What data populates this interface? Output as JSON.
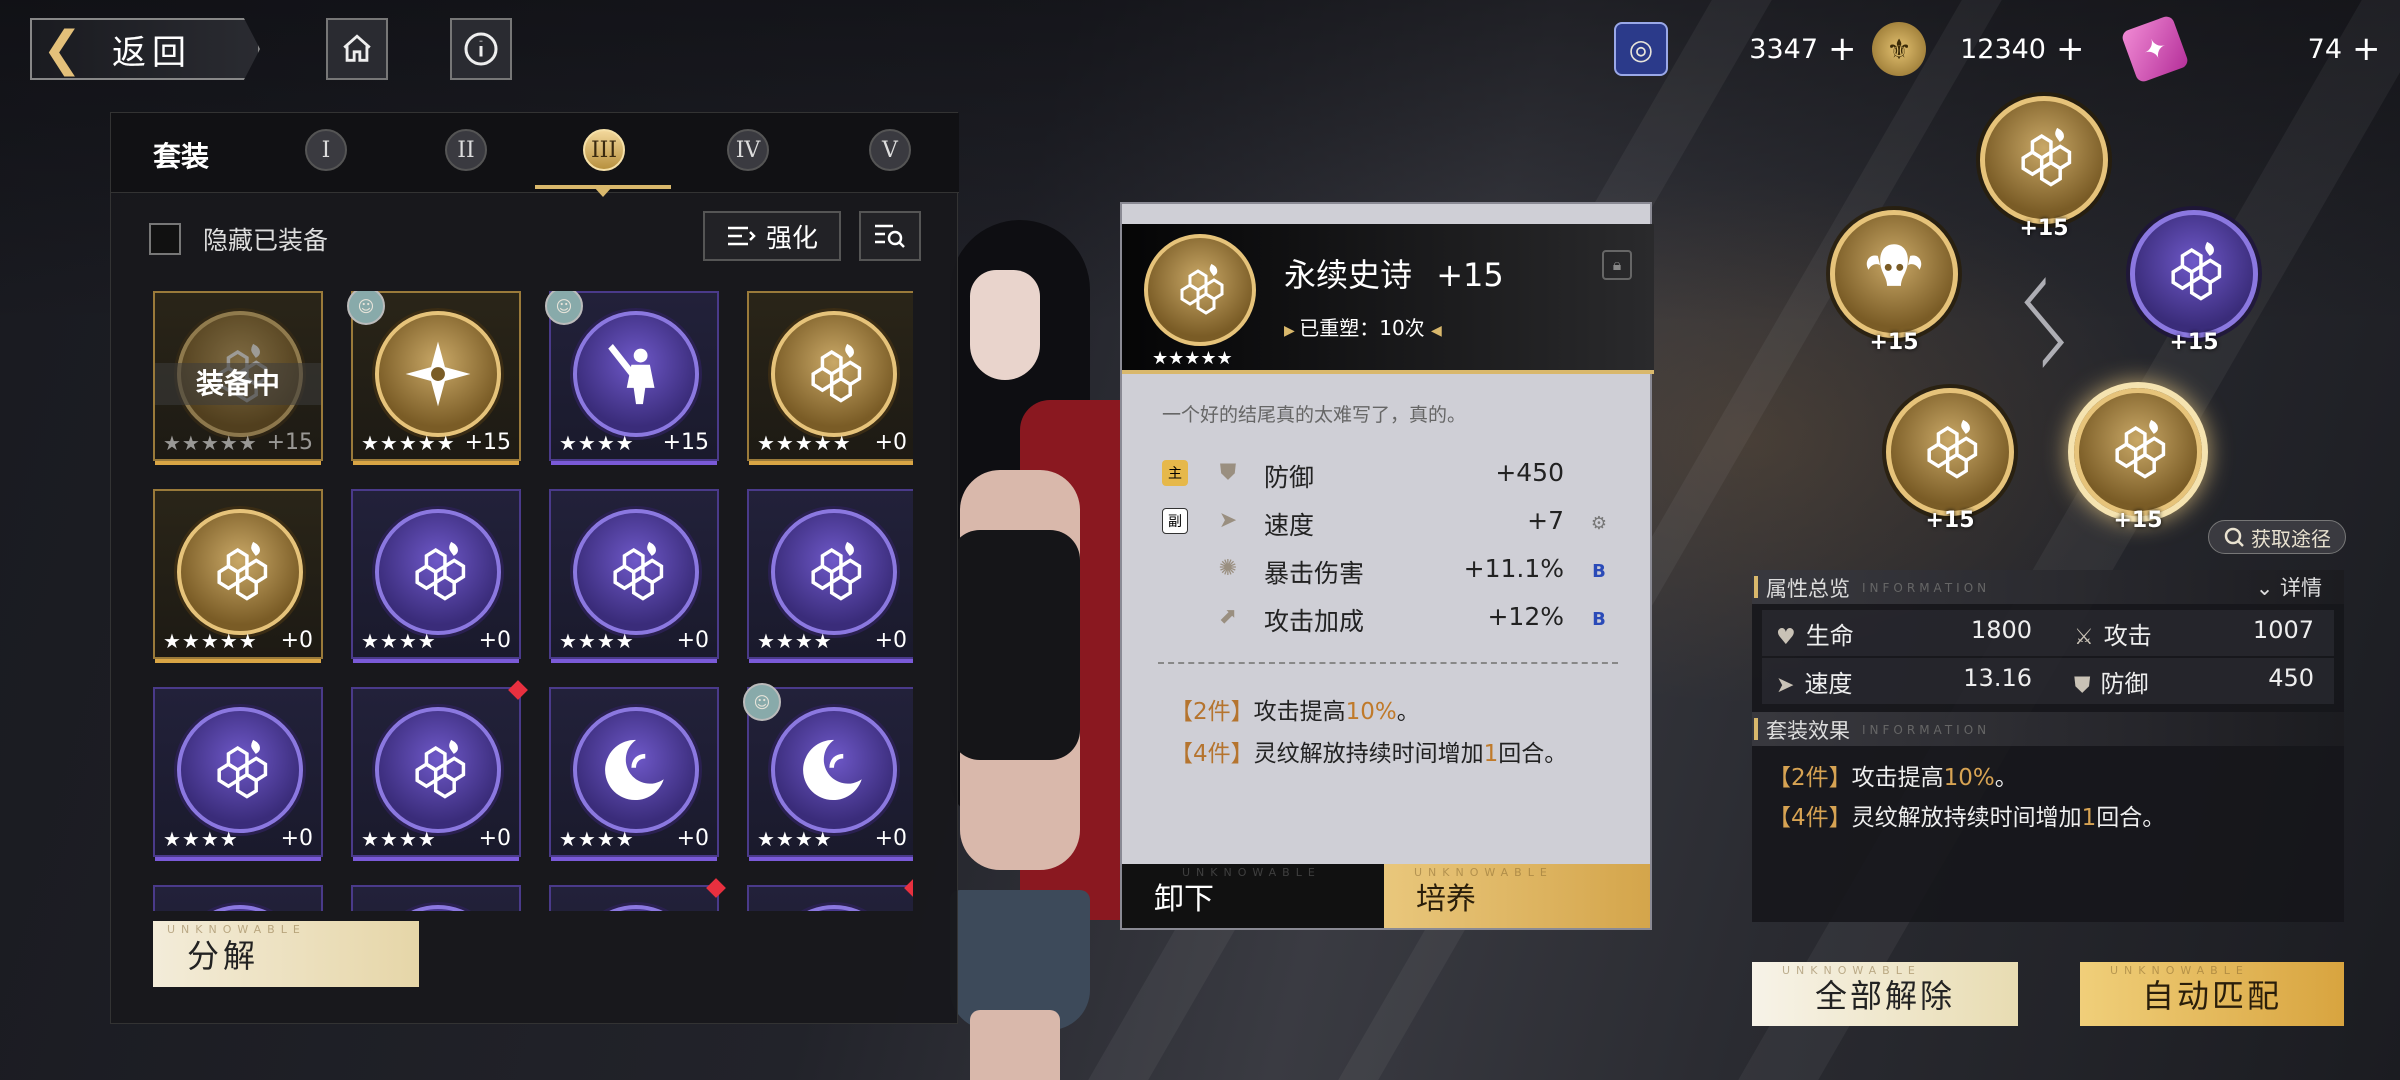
{
  "topbar": {
    "back_label": "返回",
    "home_icon": "home-icon",
    "info_icon": "info-icon",
    "currencies": [
      {
        "icon": "ticket-card-icon",
        "value": "3347",
        "color": "#3a5cc9"
      },
      {
        "icon": "fleur-coin-icon",
        "value": "12340",
        "color": "#c9a24a"
      },
      {
        "icon": "pink-crystal-icon",
        "value": "74",
        "color": "#d84fb5"
      }
    ],
    "plus": "+"
  },
  "left_panel": {
    "title": "套装",
    "tabs": [
      "I",
      "II",
      "III",
      "IV",
      "V"
    ],
    "active_tab": 2,
    "hide_equipped_label": "隐藏已装备",
    "enhance_label": "强化",
    "decompose_label": "分解",
    "watermark": "UNKNOWABLE",
    "cards": [
      {
        "frame": "gold",
        "icon": "hexagon-cluster-icon",
        "stars": "★★★★★",
        "level": "+15",
        "equipped": "装备中",
        "dim": true
      },
      {
        "frame": "gold",
        "icon": "shuriken-star-icon",
        "stars": "★★★★★",
        "level": "+15",
        "avatar": true
      },
      {
        "frame": "purple",
        "icon": "sword-warrior-icon",
        "stars": "★★★★",
        "level": "+15",
        "avatar": true
      },
      {
        "frame": "gold",
        "icon": "hexagon-cluster-icon",
        "stars": "★★★★★",
        "level": "+0"
      },
      {
        "frame": "gold",
        "icon": "hexagon-cluster-icon",
        "stars": "★★★★★",
        "level": "+0"
      },
      {
        "frame": "purple",
        "icon": "hexagon-cluster-icon",
        "stars": "★★★★",
        "level": "+0"
      },
      {
        "frame": "purple",
        "icon": "hexagon-cluster-icon",
        "stars": "★★★★",
        "level": "+0"
      },
      {
        "frame": "purple",
        "icon": "hexagon-cluster-icon",
        "stars": "★★★★",
        "level": "+0"
      },
      {
        "frame": "purple",
        "icon": "hexagon-cluster-icon",
        "stars": "★★★★",
        "level": "+0"
      },
      {
        "frame": "purple",
        "icon": "hexagon-cluster-icon",
        "stars": "★★★★",
        "level": "+0",
        "red": true
      },
      {
        "frame": "purple",
        "icon": "crescent-swirl-icon",
        "stars": "★★★★",
        "level": "+0"
      },
      {
        "frame": "purple",
        "icon": "crescent-swirl-icon",
        "stars": "★★★★",
        "level": "+0",
        "avatar": true
      },
      {
        "frame": "purple",
        "icon": "hexagon-cluster-icon",
        "stars": "",
        "level": ""
      },
      {
        "frame": "purple",
        "icon": "hexagon-cluster-icon",
        "stars": "",
        "level": ""
      },
      {
        "frame": "purple",
        "icon": "hexagon-cluster-icon",
        "stars": "",
        "level": "",
        "red": true
      },
      {
        "frame": "purple",
        "icon": "hexagon-cluster-icon",
        "stars": "",
        "level": "",
        "red": true
      }
    ]
  },
  "detail": {
    "name": "永续史诗",
    "level": "+15",
    "stars": "★★★★★",
    "reforge": "已重塑：10次",
    "flavor": "一个好的结尾真的太难写了，真的。",
    "stats": [
      {
        "tag": "主",
        "icon": "shield-icon",
        "name": "防御",
        "value": "+450",
        "suffix": ""
      },
      {
        "tag": "副",
        "icon": "speed-boot-icon",
        "name": "速度",
        "value": "+7",
        "suffix": "gear"
      },
      {
        "tag": "",
        "icon": "crit-damage-icon",
        "name": "暴击伤害",
        "value": "+11.1%",
        "suffix": "B"
      },
      {
        "tag": "",
        "icon": "attack-boost-icon",
        "name": "攻击加成",
        "value": "+12%",
        "suffix": "B"
      }
    ],
    "set2_bracket": "【2件】",
    "set2_text": "攻击提高",
    "set2_value": "10%",
    "set2_end": "。",
    "set4_bracket": "【4件】",
    "set4_text": "灵纹解放持续时间增加",
    "set4_value": "1",
    "set4_end": "回合。",
    "unequip_label": "卸下",
    "train_label": "培养",
    "watermark": "UNKNOWABLE"
  },
  "slots": [
    {
      "frame": "gold",
      "icon": "hexagon-cluster-icon",
      "level": "+15"
    },
    {
      "frame": "gold",
      "icon": "ram-skull-icon",
      "level": "+15"
    },
    {
      "frame": "purple",
      "icon": "hexagon-cluster-icon",
      "level": "+15"
    },
    {
      "frame": "gold",
      "icon": "hexagon-cluster-icon",
      "level": "+15"
    },
    {
      "frame": "gold",
      "icon": "hexagon-cluster-icon",
      "level": "+15"
    }
  ],
  "obtain_label": "获取途径",
  "attributes": {
    "title": "属性总览",
    "title_en": "INFORMATION",
    "detail_link": "详情",
    "rows": [
      {
        "a_icon": "heart-icon",
        "a_name": "生命",
        "a_val": "1800",
        "b_icon": "sword-icon",
        "b_name": "攻击",
        "b_val": "1007"
      },
      {
        "a_icon": "speed-icon",
        "a_name": "速度",
        "a_val": "13.16",
        "b_icon": "shield-icon",
        "b_name": "防御",
        "b_val": "450"
      }
    ]
  },
  "set_effect": {
    "title": "套装效果",
    "title_en": "INFORMATION",
    "set2_bracket": "【2件】",
    "set2_text": "攻击提高",
    "set2_value": "10%",
    "set2_end": "。",
    "set4_bracket": "【4件】",
    "set4_text": "灵纹解放持续时间增加",
    "set4_value": "1",
    "set4_end": "回合。"
  },
  "buttons": {
    "remove_all": "全部解除",
    "auto_match": "自动匹配",
    "watermark": "UNKNOWABLE"
  }
}
